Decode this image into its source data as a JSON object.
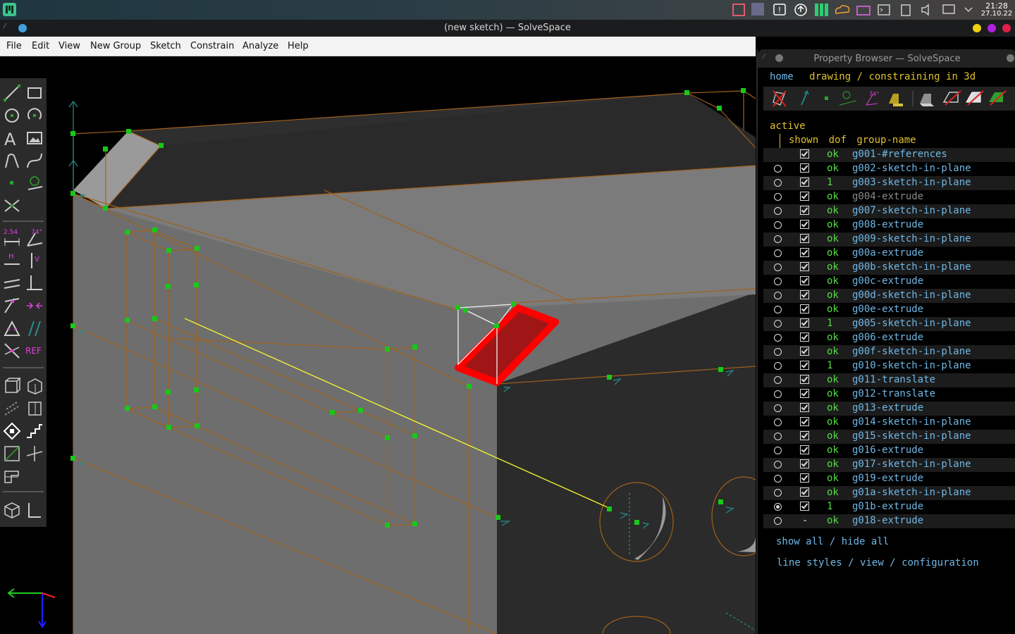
{
  "taskbar": {
    "clock_time": "21:28",
    "clock_date": "27.10.22",
    "tray_icons": [
      "app-icon",
      "storage-icon",
      "notification-icon",
      "update-icon",
      "app-grid-icon",
      "cloud-icon",
      "inbox-icon",
      "terminal-icon",
      "clipboard-icon",
      "volume-icon",
      "network-icon",
      "chevron-down-icon"
    ]
  },
  "window": {
    "title": "(new sketch) — SolveSpace"
  },
  "menu": {
    "items": [
      "File",
      "Edit",
      "View",
      "New Group",
      "Sketch",
      "Constrain",
      "Analyze",
      "Help"
    ]
  },
  "toolbar": {
    "labels": {
      "distance": "2.54",
      "angle": "74°",
      "horizontal": "H",
      "vertical": "V",
      "reference": "REF"
    }
  },
  "property_browser": {
    "title": "Property Browser — SolveSpace",
    "nav": {
      "home": "home",
      "mode": "drawing / constraining in 3d"
    },
    "header": {
      "active": "active",
      "shown": "shown",
      "dof": "dof",
      "group_name": "group-name"
    },
    "groups": [
      {
        "name": "g001-#references",
        "dof": "ok",
        "shown": true,
        "active": false,
        "radio": false,
        "color": "#6fb7e6"
      },
      {
        "name": "g002-sketch-in-plane",
        "dof": "ok",
        "shown": true,
        "active": false,
        "radio": true,
        "color": "#6fb7e6"
      },
      {
        "name": "g003-sketch-in-plane",
        "dof": "1",
        "shown": true,
        "active": false,
        "radio": true,
        "color": "#6fb7e6"
      },
      {
        "name": "g004-extrude",
        "dof": "ok",
        "shown": true,
        "active": false,
        "radio": true,
        "color": "#8a8a8a"
      },
      {
        "name": "g007-sketch-in-plane",
        "dof": "ok",
        "shown": true,
        "active": false,
        "radio": true,
        "color": "#6fb7e6"
      },
      {
        "name": "g008-extrude",
        "dof": "ok",
        "shown": true,
        "active": false,
        "radio": true,
        "color": "#6fb7e6"
      },
      {
        "name": "g009-sketch-in-plane",
        "dof": "ok",
        "shown": true,
        "active": false,
        "radio": true,
        "color": "#6fb7e6"
      },
      {
        "name": "g00a-extrude",
        "dof": "ok",
        "shown": true,
        "active": false,
        "radio": true,
        "color": "#6fb7e6"
      },
      {
        "name": "g00b-sketch-in-plane",
        "dof": "ok",
        "shown": true,
        "active": false,
        "radio": true,
        "color": "#6fb7e6"
      },
      {
        "name": "g00c-extrude",
        "dof": "ok",
        "shown": true,
        "active": false,
        "radio": true,
        "color": "#6fb7e6"
      },
      {
        "name": "g00d-sketch-in-plane",
        "dof": "ok",
        "shown": true,
        "active": false,
        "radio": true,
        "color": "#6fb7e6"
      },
      {
        "name": "g00e-extrude",
        "dof": "ok",
        "shown": true,
        "active": false,
        "radio": true,
        "color": "#6fb7e6"
      },
      {
        "name": "g005-sketch-in-plane",
        "dof": "1",
        "shown": true,
        "active": false,
        "radio": true,
        "color": "#6fb7e6"
      },
      {
        "name": "g006-extrude",
        "dof": "ok",
        "shown": true,
        "active": false,
        "radio": true,
        "color": "#6fb7e6"
      },
      {
        "name": "g00f-sketch-in-plane",
        "dof": "ok",
        "shown": true,
        "active": false,
        "radio": true,
        "color": "#6fb7e6"
      },
      {
        "name": "g010-sketch-in-plane",
        "dof": "1",
        "shown": true,
        "active": false,
        "radio": true,
        "color": "#6fb7e6"
      },
      {
        "name": "g011-translate",
        "dof": "ok",
        "shown": true,
        "active": false,
        "radio": true,
        "color": "#6fb7e6"
      },
      {
        "name": "g012-translate",
        "dof": "ok",
        "shown": true,
        "active": false,
        "radio": true,
        "color": "#6fb7e6"
      },
      {
        "name": "g013-extrude",
        "dof": "ok",
        "shown": true,
        "active": false,
        "radio": true,
        "color": "#6fb7e6"
      },
      {
        "name": "g014-sketch-in-plane",
        "dof": "ok",
        "shown": true,
        "active": false,
        "radio": true,
        "color": "#6fb7e6"
      },
      {
        "name": "g015-sketch-in-plane",
        "dof": "ok",
        "shown": true,
        "active": false,
        "radio": true,
        "color": "#6fb7e6"
      },
      {
        "name": "g016-extrude",
        "dof": "ok",
        "shown": true,
        "active": false,
        "radio": true,
        "color": "#6fb7e6"
      },
      {
        "name": "g017-sketch-in-plane",
        "dof": "ok",
        "shown": true,
        "active": false,
        "radio": true,
        "color": "#6fb7e6"
      },
      {
        "name": "g019-extrude",
        "dof": "ok",
        "shown": true,
        "active": false,
        "radio": true,
        "color": "#6fb7e6"
      },
      {
        "name": "g01a-sketch-in-plane",
        "dof": "ok",
        "shown": true,
        "active": false,
        "radio": true,
        "color": "#6fb7e6"
      },
      {
        "name": "g01b-extrude",
        "dof": "1",
        "shown": true,
        "active": true,
        "radio": true,
        "color": "#6fb7e6"
      },
      {
        "name": "g018-extrude",
        "dof": "ok",
        "shown": "-",
        "active": false,
        "radio": true,
        "color": "#6fb7e6"
      }
    ],
    "footer": {
      "show_all": "show all",
      "sep1": "/",
      "hide_all": "hide all",
      "line_styles": "line styles",
      "sep2": "/",
      "view": "view",
      "sep3": "/",
      "configuration": "configuration"
    }
  }
}
